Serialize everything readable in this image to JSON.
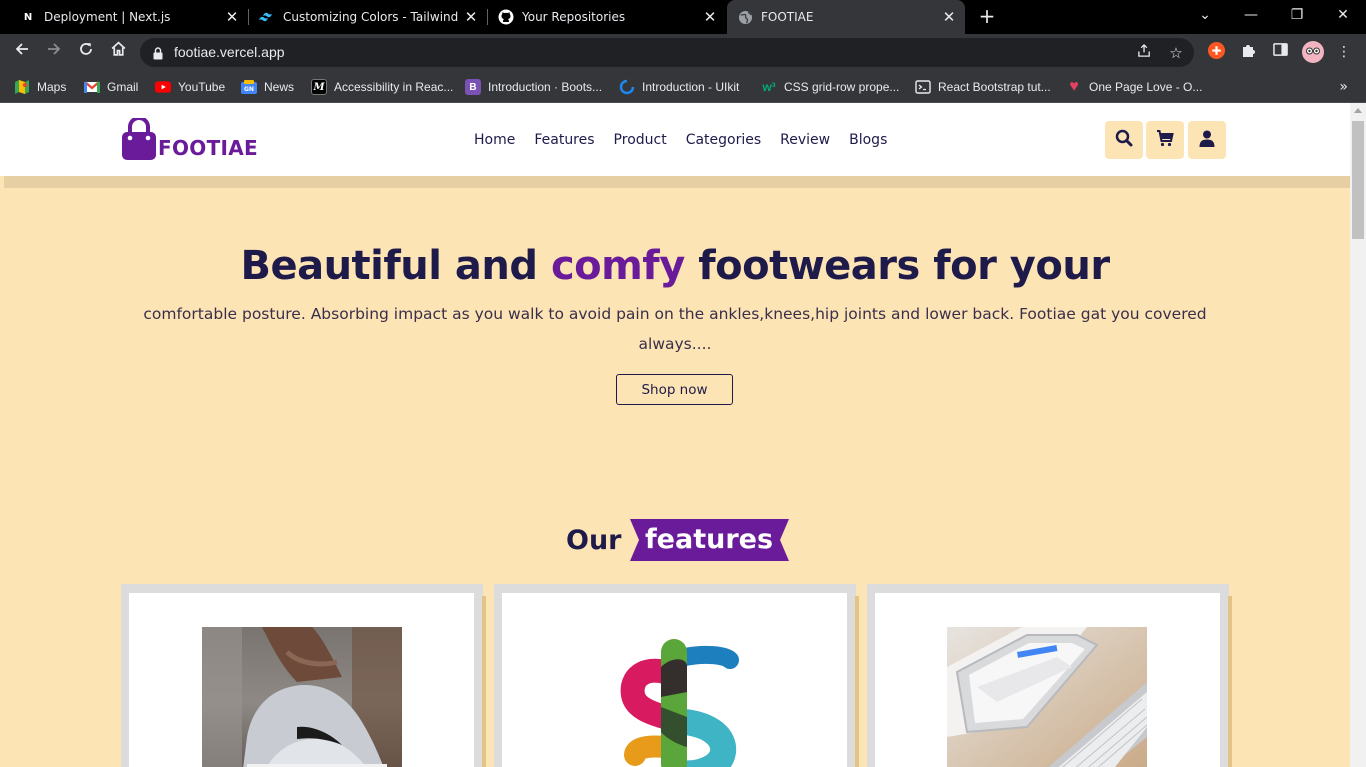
{
  "browser": {
    "tabs": [
      {
        "title": "Deployment | Next.js",
        "icon": "nextjs-icon"
      },
      {
        "title": "Customizing Colors - Tailwind CSS",
        "icon": "tailwind-icon"
      },
      {
        "title": "Your Repositories",
        "icon": "github-icon"
      },
      {
        "title": "FOOTIAE",
        "icon": "globe-icon",
        "active": true
      }
    ],
    "url": "footiae.vercel.app",
    "bookmarks": [
      {
        "label": "Maps",
        "icon": "maps-icon",
        "color": "#34a853"
      },
      {
        "label": "Gmail",
        "icon": "gmail-icon",
        "color": "#ea4335"
      },
      {
        "label": "YouTube",
        "icon": "youtube-icon",
        "color": "#ff0000"
      },
      {
        "label": "News",
        "icon": "news-icon",
        "color": "#4285f4"
      },
      {
        "label": "Accessibility in Reac...",
        "icon": "medium-icon",
        "color": "#000000"
      },
      {
        "label": "Introduction · Boots...",
        "icon": "bootstrap-icon",
        "color": "#7952b3"
      },
      {
        "label": "Introduction - UIkit",
        "icon": "uikit-icon",
        "color": "#1e87f0"
      },
      {
        "label": "CSS grid-row prope...",
        "icon": "w3schools-icon",
        "color": "#04aa6d"
      },
      {
        "label": "React Bootstrap tut...",
        "icon": "terminal-icon",
        "color": "#5f6368"
      },
      {
        "label": "One Page Love - O...",
        "icon": "heart-icon",
        "color": "#e4405f"
      }
    ]
  },
  "site": {
    "brand": "FOOTIAE",
    "nav": [
      "Home",
      "Features",
      "Product",
      "Categories",
      "Review",
      "Blogs"
    ],
    "hero": {
      "title_part1": "Beautiful and",
      "title_accent": "comfy",
      "title_part2": "footwears for your",
      "description": "comfortable posture. Absorbing impact as you walk to avoid pain on the ankles,knees,hip joints and lower back. Footiae gat you covered always....",
      "cta": "Shop now"
    },
    "features": {
      "heading_plain": "Our",
      "heading_ribbon": "features",
      "cards": [
        {
          "image": "sneaker-photo"
        },
        {
          "image": "dollar-sign-graphic"
        },
        {
          "image": "tablet-keyboard-photo"
        }
      ]
    }
  },
  "colors": {
    "page_bg": "#fde4b5",
    "brand_purple": "#6a1b9a",
    "navy": "#1e1b4b",
    "header_bg": "#ffffff"
  }
}
